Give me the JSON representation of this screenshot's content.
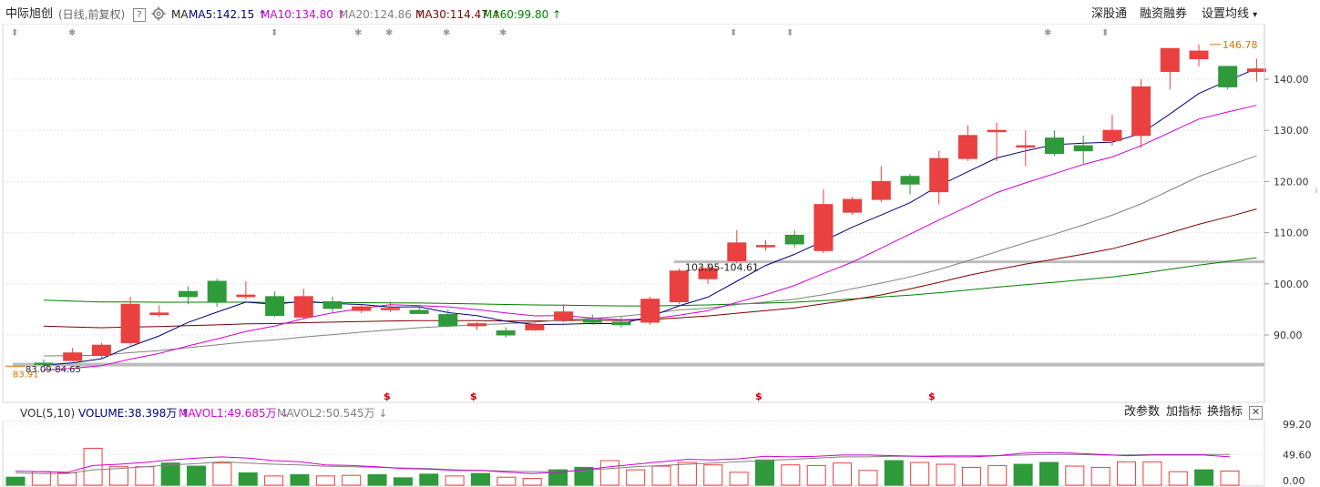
{
  "header": {
    "stock_name": "中际旭创",
    "mode": "(日线,前复权)",
    "help_icon": "?",
    "settings_icon": "gear-icon",
    "ma_label": "MA",
    "ma": [
      {
        "label": "MA5:142.15",
        "arrow": "↑",
        "color": "#000080"
      },
      {
        "label": "MA10:134.80",
        "arrow": "↑",
        "color": "#d400d4"
      },
      {
        "label": "MA20:124.86",
        "arrow": "↑",
        "color": "#808080"
      },
      {
        "label": "MA30:114.47",
        "arrow": "↑",
        "color": "#800000"
      },
      {
        "label": "MA60:99.80",
        "arrow": "↑",
        "color": "#008000"
      }
    ],
    "links": [
      "深股通",
      "融资融券",
      "设置均线"
    ],
    "dropdown_arrow": "▾"
  },
  "price_axis": [
    "140.00",
    "130.00",
    "120.00",
    "110.00",
    "100.00",
    "90.00"
  ],
  "annotations": {
    "high": "146.78",
    "low": "83.91",
    "low_range": "83.09-84.65",
    "gap_range": "103.95-104.61",
    "marker_symbol": "$",
    "event_symbol_1": "⬍",
    "event_symbol_2": "✱"
  },
  "volume": {
    "label": "VOL(5,10)",
    "volume": "VOLUME:38.398万",
    "mavol1": "MAVOL1:49.685万",
    "mavol2": "MAVOL2:50.545万",
    "arrows": [
      "↑",
      "↓",
      "↓"
    ],
    "axis": [
      "99.20",
      "49.60",
      "0.00"
    ],
    "buttons": [
      "改参数",
      "加指标",
      "换指标"
    ],
    "close": "✕"
  },
  "colors": {
    "up": "#e94040",
    "down": "#2f9a3a",
    "ma5": "#000080",
    "ma10": "#d400d4",
    "ma20": "#808080",
    "ma30": "#800000",
    "ma60": "#008000"
  },
  "chart_data": {
    "type": "candlestick",
    "ylim": [
      82,
      148
    ],
    "candles": [
      {
        "o": 84.5,
        "h": 85.2,
        "l": 83.9,
        "c": 84.3
      },
      {
        "o": 85.0,
        "h": 87.5,
        "l": 84.8,
        "c": 86.5
      },
      {
        "o": 86.0,
        "h": 88.5,
        "l": 85.5,
        "c": 88.0
      },
      {
        "o": 88.5,
        "h": 97.5,
        "l": 88.0,
        "c": 96.0
      },
      {
        "o": 94.0,
        "h": 95.8,
        "l": 93.5,
        "c": 94.3
      },
      {
        "o": 98.5,
        "h": 99.5,
        "l": 96.0,
        "c": 97.5
      },
      {
        "o": 100.5,
        "h": 101.0,
        "l": 95.5,
        "c": 96.5
      },
      {
        "o": 97.5,
        "h": 100.5,
        "l": 97.0,
        "c": 97.8
      },
      {
        "o": 97.5,
        "h": 98.5,
        "l": 93.5,
        "c": 93.8
      },
      {
        "o": 93.5,
        "h": 99.0,
        "l": 93.0,
        "c": 97.5
      },
      {
        "o": 96.5,
        "h": 97.5,
        "l": 94.5,
        "c": 95.2
      },
      {
        "o": 94.8,
        "h": 96.0,
        "l": 94.3,
        "c": 95.5
      },
      {
        "o": 95.0,
        "h": 96.5,
        "l": 94.5,
        "c": 95.2
      },
      {
        "o": 94.8,
        "h": 95.8,
        "l": 94.2,
        "c": 94.2
      },
      {
        "o": 94.0,
        "h": 95.0,
        "l": 91.5,
        "c": 91.8
      },
      {
        "o": 91.8,
        "h": 92.5,
        "l": 91.0,
        "c": 92.2
      },
      {
        "o": 90.8,
        "h": 91.5,
        "l": 89.5,
        "c": 90.0
      },
      {
        "o": 91.0,
        "h": 92.5,
        "l": 90.8,
        "c": 92.0
      },
      {
        "o": 93.0,
        "h": 96.0,
        "l": 92.5,
        "c": 94.5
      },
      {
        "o": 93.0,
        "h": 94.0,
        "l": 92.0,
        "c": 92.5
      },
      {
        "o": 92.5,
        "h": 93.5,
        "l": 91.5,
        "c": 92.0
      },
      {
        "o": 92.5,
        "h": 97.5,
        "l": 92.0,
        "c": 97.0
      },
      {
        "o": 96.5,
        "h": 103.0,
        "l": 96.0,
        "c": 102.5
      },
      {
        "o": 101.0,
        "h": 104.0,
        "l": 100.0,
        "c": 103.0
      },
      {
        "o": 104.5,
        "h": 110.5,
        "l": 104.0,
        "c": 108.0
      },
      {
        "o": 107.5,
        "h": 108.5,
        "l": 106.5,
        "c": 107.5
      },
      {
        "o": 109.5,
        "h": 110.5,
        "l": 107.0,
        "c": 107.8
      },
      {
        "o": 106.5,
        "h": 118.5,
        "l": 106.0,
        "c": 115.5
      },
      {
        "o": 114.0,
        "h": 117.0,
        "l": 113.5,
        "c": 116.5
      },
      {
        "o": 116.5,
        "h": 123.0,
        "l": 116.0,
        "c": 120.0
      },
      {
        "o": 121.0,
        "h": 121.5,
        "l": 117.5,
        "c": 119.5
      },
      {
        "o": 118.0,
        "h": 126.0,
        "l": 115.5,
        "c": 124.5
      },
      {
        "o": 124.5,
        "h": 131.0,
        "l": 124.0,
        "c": 129.0
      },
      {
        "o": 130.0,
        "h": 131.5,
        "l": 124.0,
        "c": 130.0
      },
      {
        "o": 127.0,
        "h": 130.0,
        "l": 123.0,
        "c": 127.0
      },
      {
        "o": 128.5,
        "h": 130.0,
        "l": 125.0,
        "c": 125.5
      },
      {
        "o": 127.0,
        "h": 129.0,
        "l": 123.5,
        "c": 126.0
      },
      {
        "o": 128.0,
        "h": 133.0,
        "l": 127.0,
        "c": 130.0
      },
      {
        "o": 129.0,
        "h": 140.0,
        "l": 126.5,
        "c": 138.5
      },
      {
        "o": 141.5,
        "h": 146.0,
        "l": 138.0,
        "c": 146.0
      },
      {
        "o": 144.0,
        "h": 146.8,
        "l": 142.5,
        "c": 145.5
      },
      {
        "o": 142.5,
        "h": 142.5,
        "l": 138.0,
        "c": 138.5
      },
      {
        "o": 141.5,
        "h": 144.0,
        "l": 139.5,
        "c": 142.0
      }
    ],
    "volume_ylim": [
      0,
      99.2
    ],
    "volume_values": [
      13,
      22,
      20,
      60,
      30,
      30,
      36,
      31,
      36,
      20,
      15,
      17,
      15,
      16,
      17,
      12,
      18,
      15,
      19,
      13,
      11,
      25,
      29,
      40,
      25,
      31,
      37,
      33,
      21,
      41,
      33,
      32,
      36,
      24,
      40,
      37,
      34,
      29,
      32,
      34,
      37,
      31,
      29,
      38,
      38,
      22,
      25,
      23
    ],
    "vol_mavol1": [
      23,
      22,
      21,
      32,
      34,
      37,
      41,
      44,
      46,
      44,
      40,
      38,
      33,
      32,
      30,
      27,
      26,
      24,
      24,
      21,
      19,
      21,
      25,
      30,
      34,
      38,
      42,
      41,
      43,
      47,
      46,
      47,
      49,
      49,
      48,
      47,
      46,
      46,
      48,
      52,
      53,
      52,
      50,
      48,
      49,
      49,
      49,
      46
    ],
    "vol_mavol2": [
      20,
      19,
      19,
      25,
      27,
      30,
      33,
      35,
      38,
      36,
      34,
      33,
      31,
      30,
      29,
      28,
      27,
      25,
      24,
      23,
      22,
      22,
      24,
      27,
      30,
      32,
      34,
      36,
      38,
      40,
      42,
      44,
      46,
      46,
      47,
      47,
      48,
      48,
      48,
      49,
      50,
      50,
      49,
      49,
      50,
      50,
      50,
      50
    ]
  }
}
